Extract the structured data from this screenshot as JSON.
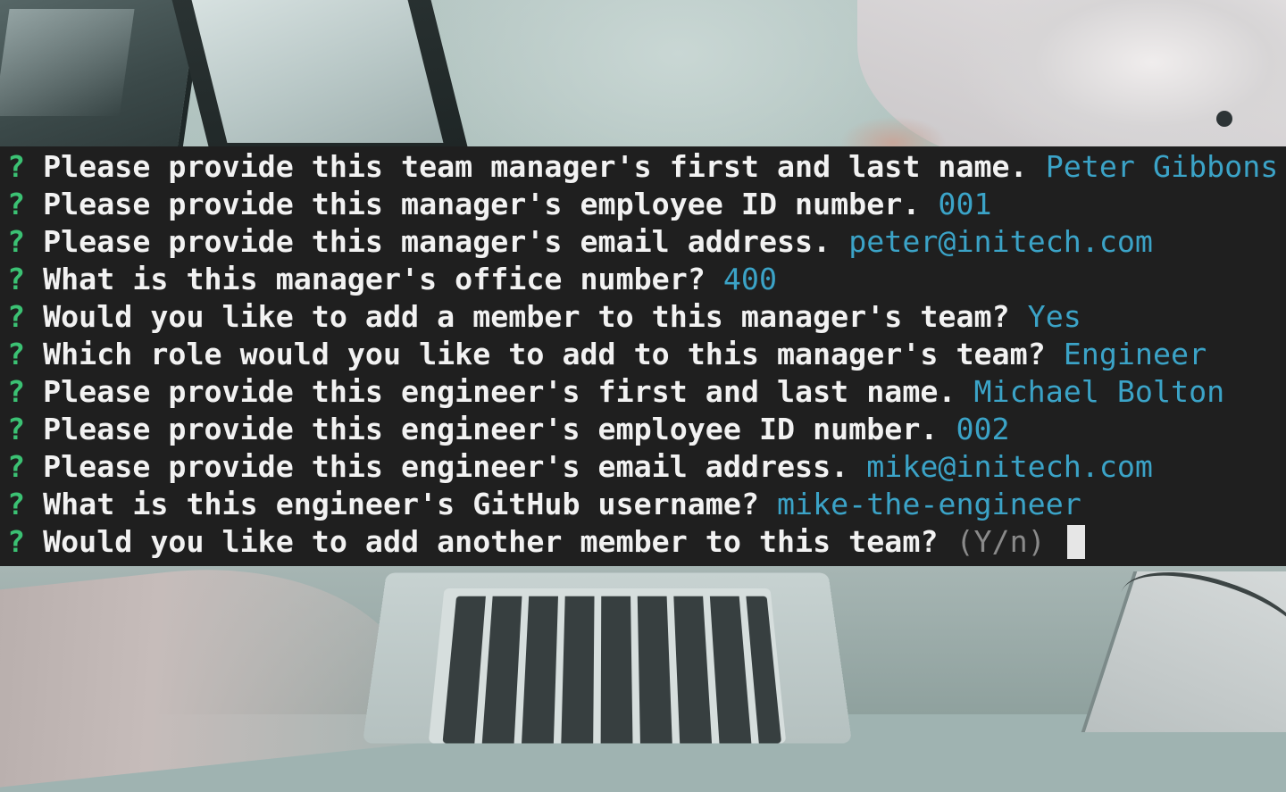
{
  "terminal": {
    "prompt_symbol": "?",
    "lines": [
      {
        "question": "Please provide this team manager's first and last name.",
        "answer": "Peter Gibbons"
      },
      {
        "question": "Please provide this manager's employee ID number.",
        "answer": "001"
      },
      {
        "question": "Please provide this manager's email address.",
        "answer": "peter@initech.com"
      },
      {
        "question": "What is this manager's office number?",
        "answer": "400"
      },
      {
        "question": "Would you like to add a member to this manager's team?",
        "answer": "Yes"
      },
      {
        "question": "Which role would you like to add to this manager's team?",
        "answer": "Engineer"
      },
      {
        "question": "Please provide this engineer's first and last name.",
        "answer": "Michael Bolton"
      },
      {
        "question": "Please provide this engineer's employee ID number.",
        "answer": "002"
      },
      {
        "question": "Please provide this engineer's email address.",
        "answer": "mike@initech.com"
      },
      {
        "question": "What is this engineer's GitHub username?",
        "answer": "mike-the-engineer"
      }
    ],
    "current_prompt": {
      "question": "Would you like to add another member to this team?",
      "hint": "(Y/n)"
    },
    "colors": {
      "background": "#1f1f1f",
      "prompt_symbol": "#3bc173",
      "question_text": "#f2f2f2",
      "answer_text": "#3ba3c7",
      "hint_text": "#8a8a8a"
    }
  }
}
